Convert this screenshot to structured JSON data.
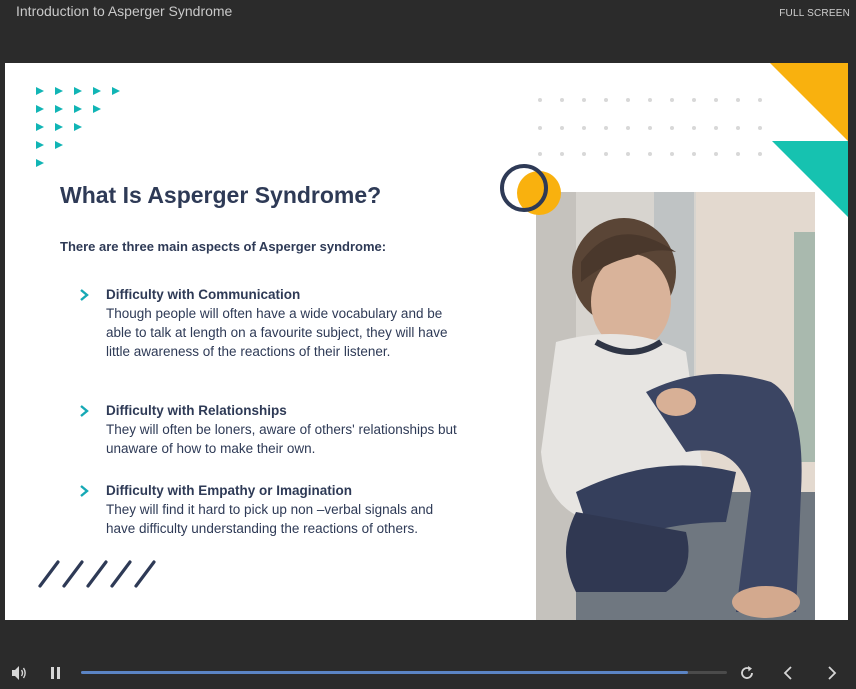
{
  "header": {
    "course_title": "Introduction to Asperger Syndrome",
    "fullscreen_label": "FULL SCREEN"
  },
  "slide": {
    "title": "What Is Asperger Syndrome?",
    "intro": "There are three main aspects of Asperger syndrome:",
    "aspects": [
      {
        "heading": "Difficulty with Communication",
        "body": "Though people will often have a wide vocabulary and be able to talk at length on a favourite subject, they will have little awareness of the reactions of their listener."
      },
      {
        "heading": "Difficulty with Relationships",
        "body": "They will often be loners, aware of others' relationships but unaware of how to make their own."
      },
      {
        "heading": "Difficulty with Empathy or Imagination",
        "body": "They will find it hard to pick up non –verbal signals and have difficulty understanding the reactions of others."
      }
    ],
    "photo_subject": "boy-sitting-by-window-photo"
  },
  "player": {
    "progress": 0.94,
    "icons": [
      "volume-icon",
      "pause-icon",
      "replay-icon",
      "previous-icon",
      "next-icon"
    ]
  },
  "colors": {
    "navy": "#2e3a56",
    "teal": "#16c2b0",
    "yellow": "#f9b10e",
    "progress": "#5b84c4",
    "background": "#2b2b2b"
  }
}
